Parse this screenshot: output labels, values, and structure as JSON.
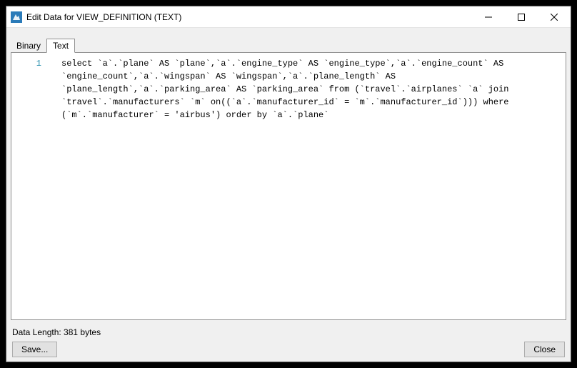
{
  "window": {
    "title": "Edit Data for VIEW_DEFINITION (TEXT)"
  },
  "tabs": {
    "binary_label": "Binary",
    "text_label": "Text"
  },
  "editor": {
    "line_number": "1",
    "sql_text": "select `a`.`plane` AS `plane`,`a`.`engine_type` AS `engine_type`,`a`.`engine_count` AS `engine_count`,`a`.`wingspan` AS `wingspan`,`a`.`plane_length` AS `plane_length`,`a`.`parking_area` AS `parking_area` from (`travel`.`airplanes` `a` join `travel`.`manufacturers` `m` on((`a`.`manufacturer_id` = `m`.`manufacturer_id`))) where (`m`.`manufacturer` = 'airbus') order by `a`.`plane`"
  },
  "status": {
    "text": "Data Length: 381 bytes"
  },
  "buttons": {
    "save_label": "Save...",
    "close_label": "Close"
  }
}
